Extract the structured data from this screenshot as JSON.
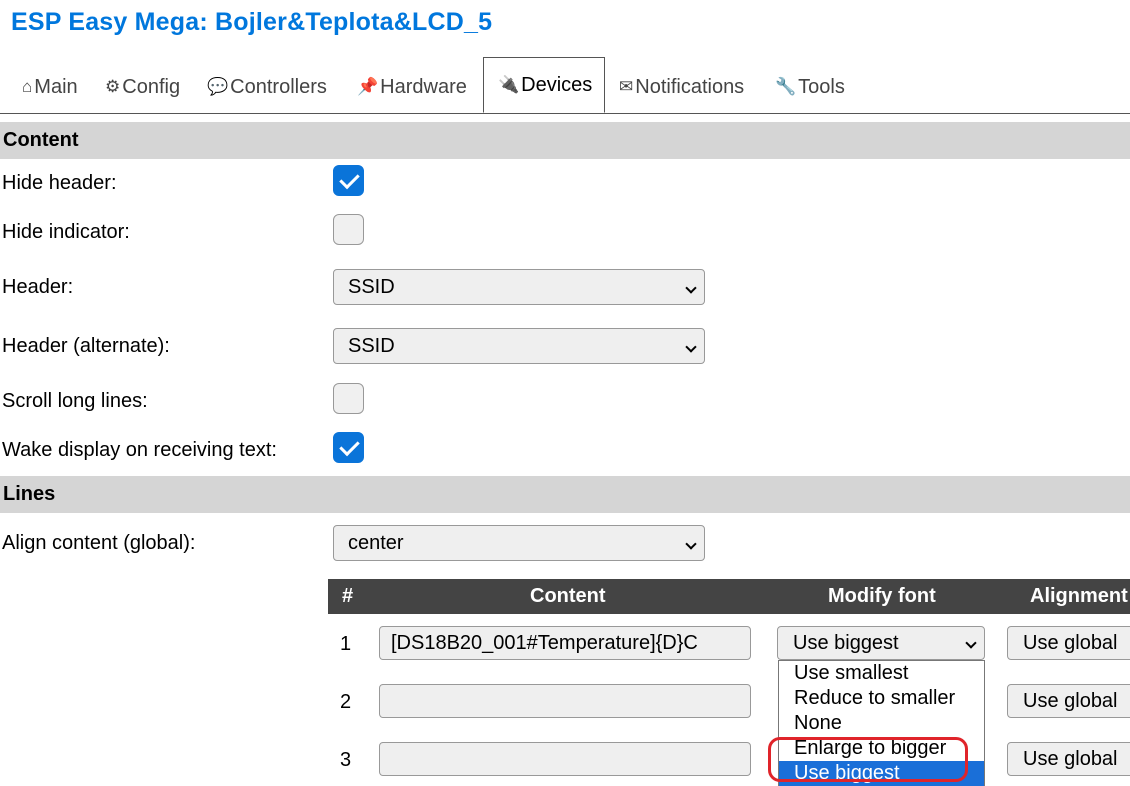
{
  "app": {
    "title": "ESP Easy Mega: Bojler&Teplota&LCD_5"
  },
  "tabs": [
    {
      "label": "Main",
      "icon": "home-icon"
    },
    {
      "label": "Config",
      "icon": "gear-icon"
    },
    {
      "label": "Controllers",
      "icon": "chat-icon"
    },
    {
      "label": "Hardware",
      "icon": "pin-icon"
    },
    {
      "label": "Devices",
      "icon": "plug-icon",
      "active": true
    },
    {
      "label": "Notifications",
      "icon": "mail-icon"
    },
    {
      "label": "Tools",
      "icon": "wrench-icon"
    }
  ],
  "content_section": {
    "heading": "Content",
    "hide_header": {
      "label": "Hide header:",
      "checked": true
    },
    "hide_indicator": {
      "label": "Hide indicator:",
      "checked": false
    },
    "header": {
      "label": "Header:",
      "value": "SSID"
    },
    "header_alternate": {
      "label": "Header (alternate):",
      "value": "SSID"
    },
    "scroll_long_lines": {
      "label": "Scroll long lines:",
      "checked": false
    },
    "wake_display": {
      "label": "Wake display on receiving text:",
      "checked": true
    }
  },
  "lines_section": {
    "heading": "Lines",
    "align_global": {
      "label": "Align content (global):",
      "value": "center"
    },
    "table": {
      "headers": {
        "num": "#",
        "content": "Content",
        "modify_font": "Modify font",
        "alignment": "Alignment"
      },
      "rows": [
        {
          "num": "1",
          "content": "[DS18B20_001#Temperature]{D}C",
          "font": "Use biggest",
          "alignment": "Use global"
        },
        {
          "num": "2",
          "content": "",
          "font": "",
          "alignment": "Use global"
        },
        {
          "num": "3",
          "content": "",
          "font": "",
          "alignment": "Use global"
        }
      ]
    },
    "font_dropdown": {
      "options": [
        "Use smallest",
        "Reduce to smaller",
        "None",
        "Enlarge to bigger",
        "Use biggest"
      ],
      "selected": "Use biggest"
    }
  },
  "colors": {
    "title": "#0077dd",
    "checkbox_on": "#0a74d9",
    "selected_option": "#1a6fd8",
    "highlight": "#e0242a",
    "table_header": "#444444",
    "section_bg": "#d5d5d5"
  }
}
